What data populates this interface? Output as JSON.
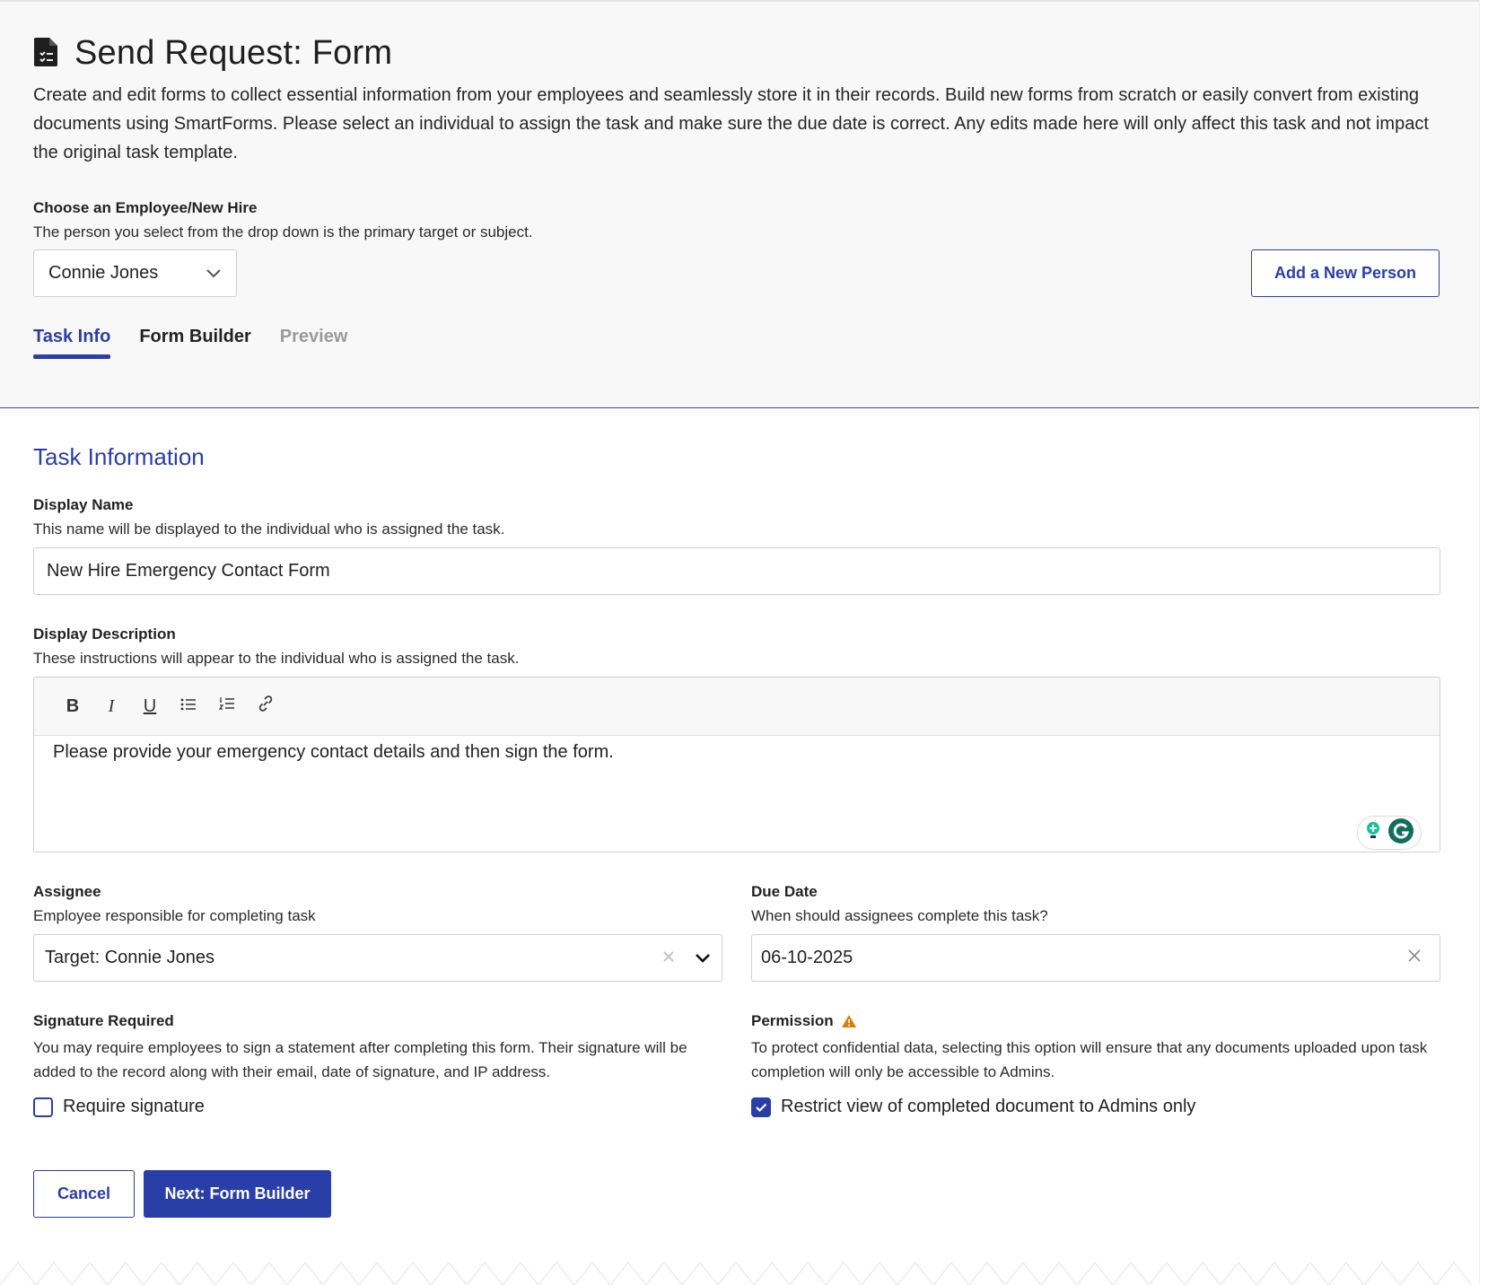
{
  "header": {
    "title": "Send Request: Form",
    "description": "Create and edit forms to collect essential information from your employees and seamlessly store it in their records. Build new forms from scratch or easily convert from existing documents using SmartForms. Please select an individual to assign the task and make sure the due date is correct. Any edits made here will only affect this task and not impact the original task template."
  },
  "employee": {
    "label": "Choose an Employee/New Hire",
    "hint": "The person you select from the drop down is the primary target or subject.",
    "selected": "Connie Jones",
    "add_button": "Add a New Person"
  },
  "tabs": [
    {
      "label": "Task Info",
      "state": "active"
    },
    {
      "label": "Form Builder",
      "state": "normal"
    },
    {
      "label": "Preview",
      "state": "disabled"
    }
  ],
  "task_info": {
    "section_title": "Task Information",
    "display_name": {
      "label": "Display Name",
      "hint": "This name will be displayed to the individual who is assigned the task.",
      "value": "New Hire Emergency Contact Form"
    },
    "display_description": {
      "label": "Display Description",
      "hint": "These instructions will appear to the individual who is assigned the task.",
      "toolbar": {
        "bold": "B",
        "italic": "I",
        "underline": "U"
      },
      "value": "Please provide your emergency contact details and then sign the form."
    },
    "assignee": {
      "label": "Assignee",
      "hint": "Employee responsible for completing task",
      "value": "Target: Connie Jones"
    },
    "due_date": {
      "label": "Due Date",
      "hint": "When should assignees complete this task?",
      "value": "06-10-2025"
    },
    "signature": {
      "label": "Signature Required",
      "hint": "You may require employees to sign a statement after completing this form. Their signature will be added to the record along with their email, date of signature, and IP address.",
      "checkbox_label": "Require signature",
      "checked": false
    },
    "permission": {
      "label": "Permission",
      "hint": "To protect confidential data, selecting this option will ensure that any documents uploaded upon task completion will only be accessible to Admins.",
      "checkbox_label": "Restrict view of completed document to Admins only",
      "checked": true
    }
  },
  "footer": {
    "cancel_label": "Cancel",
    "next_label": "Next: Form Builder"
  },
  "colors": {
    "accent": "#2a3ea8",
    "warning": "#e07b00",
    "header_bg": "#f8f8f8"
  },
  "icons": [
    "form-document-icon",
    "chevron-down-icon",
    "clear-x-icon",
    "warning-icon",
    "checkmark-icon",
    "grammarly-icon",
    "bulb-icon",
    "bullet-list-icon",
    "numbered-list-icon",
    "link-icon"
  ]
}
